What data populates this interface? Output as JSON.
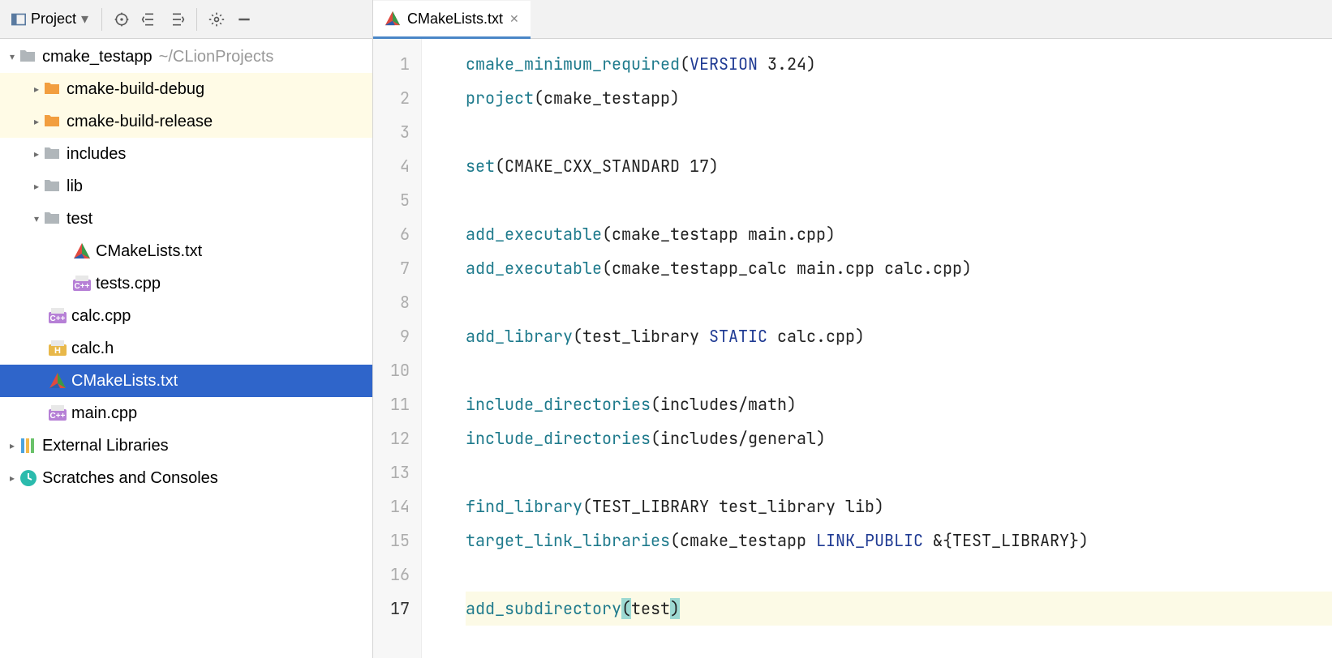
{
  "toolbar": {
    "view_label": "Project"
  },
  "tabs": [
    {
      "name": "CMakeLists.txt"
    }
  ],
  "tree": {
    "root": {
      "name": "cmake_testapp",
      "path": "~/CLionProjects"
    },
    "build_debug": "cmake-build-debug",
    "build_release": "cmake-build-release",
    "includes": "includes",
    "lib": "lib",
    "test": "test",
    "test_cmake": "CMakeLists.txt",
    "test_tests": "tests.cpp",
    "calc_cpp": "calc.cpp",
    "calc_h": "calc.h",
    "root_cmake": "CMakeLists.txt",
    "main_cpp": "main.cpp",
    "ext_lib": "External Libraries",
    "scratches": "Scratches and Consoles"
  },
  "editor": {
    "lines": [
      {
        "n": 1,
        "tokens": [
          {
            "t": "cmake_minimum_required",
            "c": "kw"
          },
          {
            "t": "(",
            "c": "plain"
          },
          {
            "t": "VERSION",
            "c": "const"
          },
          {
            "t": " 3.24)",
            "c": "plain"
          }
        ]
      },
      {
        "n": 2,
        "tokens": [
          {
            "t": "project",
            "c": "kw"
          },
          {
            "t": "(cmake_testapp)",
            "c": "plain"
          }
        ]
      },
      {
        "n": 3,
        "tokens": []
      },
      {
        "n": 4,
        "tokens": [
          {
            "t": "set",
            "c": "kw"
          },
          {
            "t": "(CMAKE_CXX_STANDARD 17)",
            "c": "plain"
          }
        ]
      },
      {
        "n": 5,
        "tokens": []
      },
      {
        "n": 6,
        "tokens": [
          {
            "t": "add_executable",
            "c": "kw"
          },
          {
            "t": "(cmake_testapp main.cpp)",
            "c": "plain"
          }
        ]
      },
      {
        "n": 7,
        "tokens": [
          {
            "t": "add_executable",
            "c": "kw"
          },
          {
            "t": "(cmake_testapp_calc main.cpp calc.cpp)",
            "c": "plain"
          }
        ]
      },
      {
        "n": 8,
        "tokens": []
      },
      {
        "n": 9,
        "tokens": [
          {
            "t": "add_library",
            "c": "kw"
          },
          {
            "t": "(test_library ",
            "c": "plain"
          },
          {
            "t": "STATIC",
            "c": "const"
          },
          {
            "t": " calc.cpp)",
            "c": "plain"
          }
        ]
      },
      {
        "n": 10,
        "tokens": []
      },
      {
        "n": 11,
        "tokens": [
          {
            "t": "include_directories",
            "c": "kw"
          },
          {
            "t": "(includes/math)",
            "c": "plain"
          }
        ]
      },
      {
        "n": 12,
        "tokens": [
          {
            "t": "include_directories",
            "c": "kw"
          },
          {
            "t": "(includes/general)",
            "c": "plain"
          }
        ]
      },
      {
        "n": 13,
        "tokens": []
      },
      {
        "n": 14,
        "tokens": [
          {
            "t": "find_library",
            "c": "kw"
          },
          {
            "t": "(TEST_LIBRARY test_library lib)",
            "c": "plain"
          }
        ]
      },
      {
        "n": 15,
        "tokens": [
          {
            "t": "target_link_libraries",
            "c": "kw"
          },
          {
            "t": "(cmake_testapp ",
            "c": "plain"
          },
          {
            "t": "LINK_PUBLIC",
            "c": "const"
          },
          {
            "t": " &{TEST_LIBRARY})",
            "c": "plain"
          }
        ]
      },
      {
        "n": 16,
        "tokens": []
      },
      {
        "n": 17,
        "hl": true,
        "tokens": [
          {
            "t": "add_subdirectory",
            "c": "kw"
          },
          {
            "t": "(",
            "c": "plain",
            "pm": true
          },
          {
            "t": "test",
            "c": "plain"
          },
          {
            "t": ")",
            "c": "plain",
            "pm": true
          }
        ]
      }
    ]
  }
}
